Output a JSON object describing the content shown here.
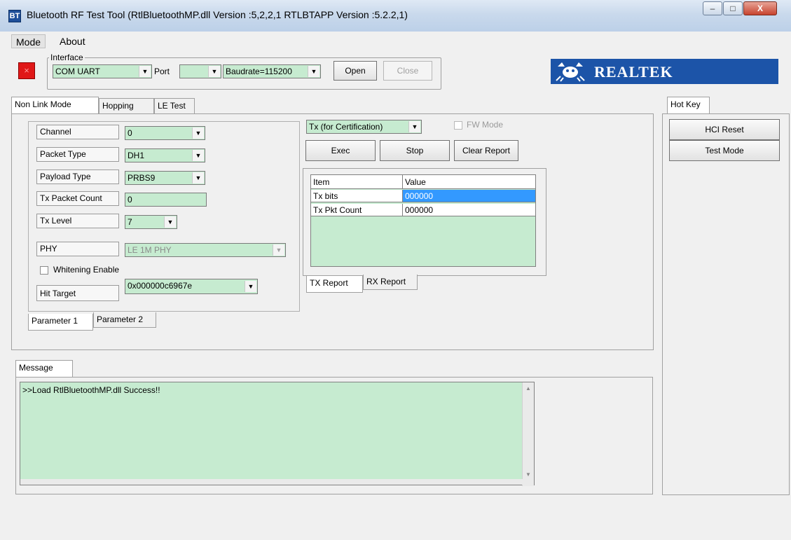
{
  "window": {
    "title": "Bluetooth RF Test Tool (RtlBluetoothMP.dll Version :5,2,2,1   RTLBTAPP Version :5.2.2,1)",
    "icon_text": "BT",
    "minimize": "–",
    "maximize": "□",
    "close": "X"
  },
  "menu": [
    "Mode",
    "About"
  ],
  "status_led": {
    "glyph": "×",
    "color": "#e01818"
  },
  "interface": {
    "legend": "Interface",
    "type": "COM UART",
    "port_label": "Port",
    "port_value": "",
    "baud": "Baudrate=115200",
    "open": "Open",
    "close": "Close"
  },
  "brand": {
    "text": "REALTEK",
    "color": "#1c54a8"
  },
  "mode_tabs": [
    "Non Link Mode",
    "Hopping",
    "LE Test"
  ],
  "params": {
    "channel_label": "Channel",
    "channel": "0",
    "packet_type_label": "Packet Type",
    "packet_type": "DH1",
    "payload_type_label": "Payload Type",
    "payload_type": "PRBS9",
    "tx_count_label": "Tx Packet Count",
    "tx_count": "0",
    "tx_level_label": "Tx Level",
    "tx_level": "7",
    "phy_label": "PHY",
    "phy": "LE 1M PHY",
    "whitening_label": "Whitening Enable",
    "hit_target_label": "Hit Target",
    "hit_target": "0x000000c6967e"
  },
  "param_tabs": [
    "Parameter 1",
    "Parameter 2"
  ],
  "test": {
    "mode": "Tx (for Certification)",
    "fw_mode": "FW Mode",
    "exec": "Exec",
    "stop": "Stop",
    "clear": "Clear Report"
  },
  "report": {
    "headers": [
      "Item",
      "Value"
    ],
    "rows": [
      {
        "item": "Tx bits",
        "value": "000000"
      },
      {
        "item": "Tx Pkt Count",
        "value": "000000"
      }
    ],
    "tabs": [
      "TX Report",
      "RX Report"
    ]
  },
  "hotkey": {
    "tab": "Hot Key",
    "hci_reset": "HCI Reset",
    "test_mode": "Test Mode"
  },
  "message": {
    "tab": "Message",
    "text": ">>Load RtlBluetoothMP.dll Success!!"
  },
  "colors": {
    "field_green": "#c6ebd0",
    "selection_blue": "#3399ff"
  }
}
